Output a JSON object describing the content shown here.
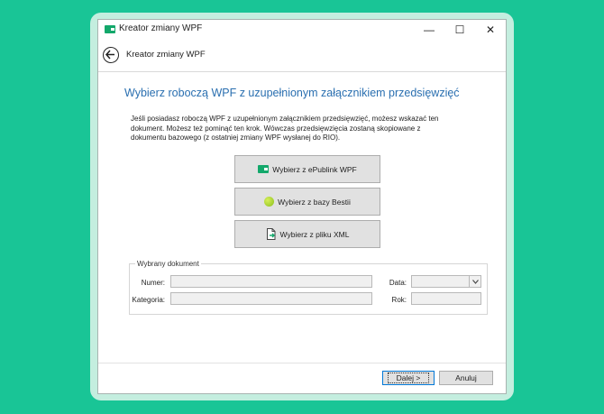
{
  "window": {
    "title": "Kreator zmiany WPF",
    "controls": {
      "minimize": "—",
      "maximize": "☐",
      "close": "✕"
    }
  },
  "nav": {
    "title": "Kreator zmiany WPF"
  },
  "main": {
    "heading": "Wybierz roboczą WPF z uzupełnionym załącznikiem przedsięwzięć",
    "description": "Jeśli posiadasz roboczą WPF z uzupełnionym załącznikiem przedsięwzięć, możesz wskazać ten dokument. Możesz też pominąć ten krok. Wówczas przedsięwzięcia zostaną skopiowane z dokumentu bazowego (z ostatniej zmiany WPF wysłanej do RIO).",
    "buttons": {
      "epublink": "Wybierz z ePublink WPF",
      "bestia": "Wybierz z bazy Bestii",
      "xml": "Wybierz z pliku XML"
    }
  },
  "selected_document": {
    "legend": "Wybrany dokument",
    "numer_label": "Numer:",
    "numer_value": "",
    "kategoria_label": "Kategoria:",
    "kategoria_value": "",
    "data_label": "Data:",
    "data_value": "",
    "rok_label": "Rok:",
    "rok_value": ""
  },
  "footer": {
    "next": "Dalej >",
    "cancel": "Anuluj"
  },
  "colors": {
    "accent": "#2a6fb0",
    "brand": "#13a86b",
    "background": "#19c596"
  }
}
